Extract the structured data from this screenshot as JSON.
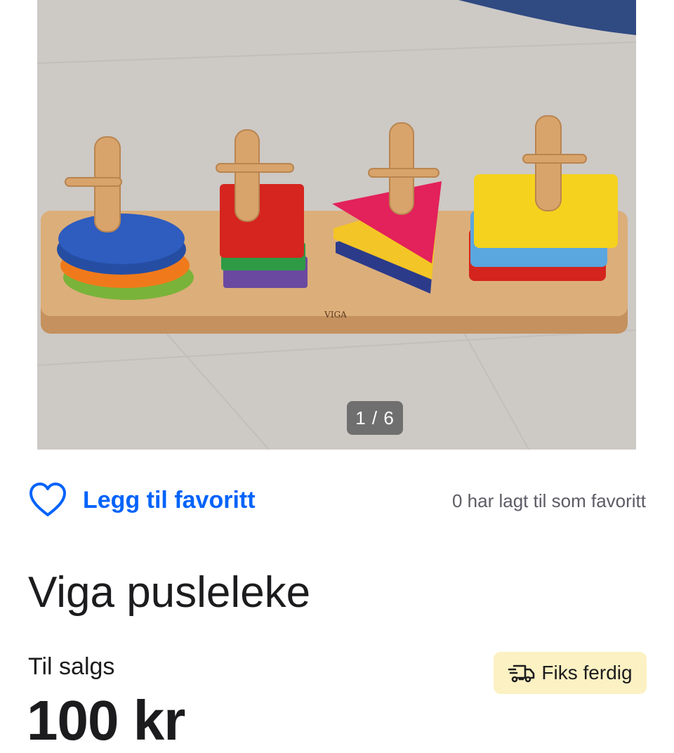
{
  "gallery": {
    "counter": "1 / 6",
    "product_brand_print": "VIGA"
  },
  "favorite": {
    "label": "Legg til favoritt",
    "count_text": "0 har lagt til som favoritt",
    "icon": "heart-outline-icon"
  },
  "listing": {
    "title": "Viga pusleleke",
    "status": "Til salgs",
    "price": "100 kr"
  },
  "shipping_badge": {
    "label": "Fiks ferdig",
    "icon": "delivery-truck-icon"
  },
  "colors": {
    "accent": "#0063fb",
    "badge_bg": "#fbf1c3",
    "text": "#1c1c1e",
    "muted": "#5c5c66"
  }
}
